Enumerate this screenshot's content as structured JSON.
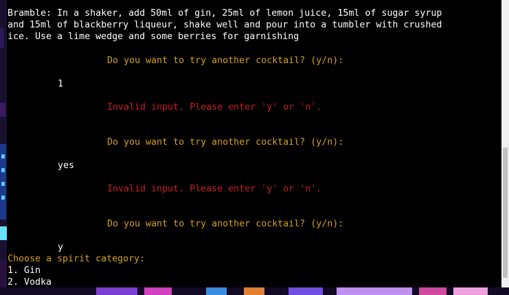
{
  "terminal": {
    "recipe_lines": [
      "Bramble: In a shaker, add 50ml of gin, 25ml of lemon juice, 15ml of sugar syrup",
      "and 15ml of blackberry liqueur, shake well and pour into a tumbler with crushed",
      "ice. Use a lime wedge and some berries for garnishing"
    ],
    "prompt_1": "Do you want to try another cocktail? (y/n):",
    "input_1": "1",
    "error_1": "Invalid input. Please enter 'y' or 'n'.",
    "prompt_2": "Do you want to try another cocktail? (y/n):",
    "input_2": "yes",
    "error_2": "Invalid input. Please enter 'y' or 'n'.",
    "prompt_3": "Do you want to try another cocktail? (y/n):",
    "input_3": "y",
    "menu_title": "Choose a spirit category:",
    "menu_items": [
      "1. Gin",
      "2. Vodka"
    ]
  },
  "colors": {
    "prompt": "#d4a017",
    "error": "#c81e1e",
    "text": "#ffffff",
    "background": "#000000"
  }
}
